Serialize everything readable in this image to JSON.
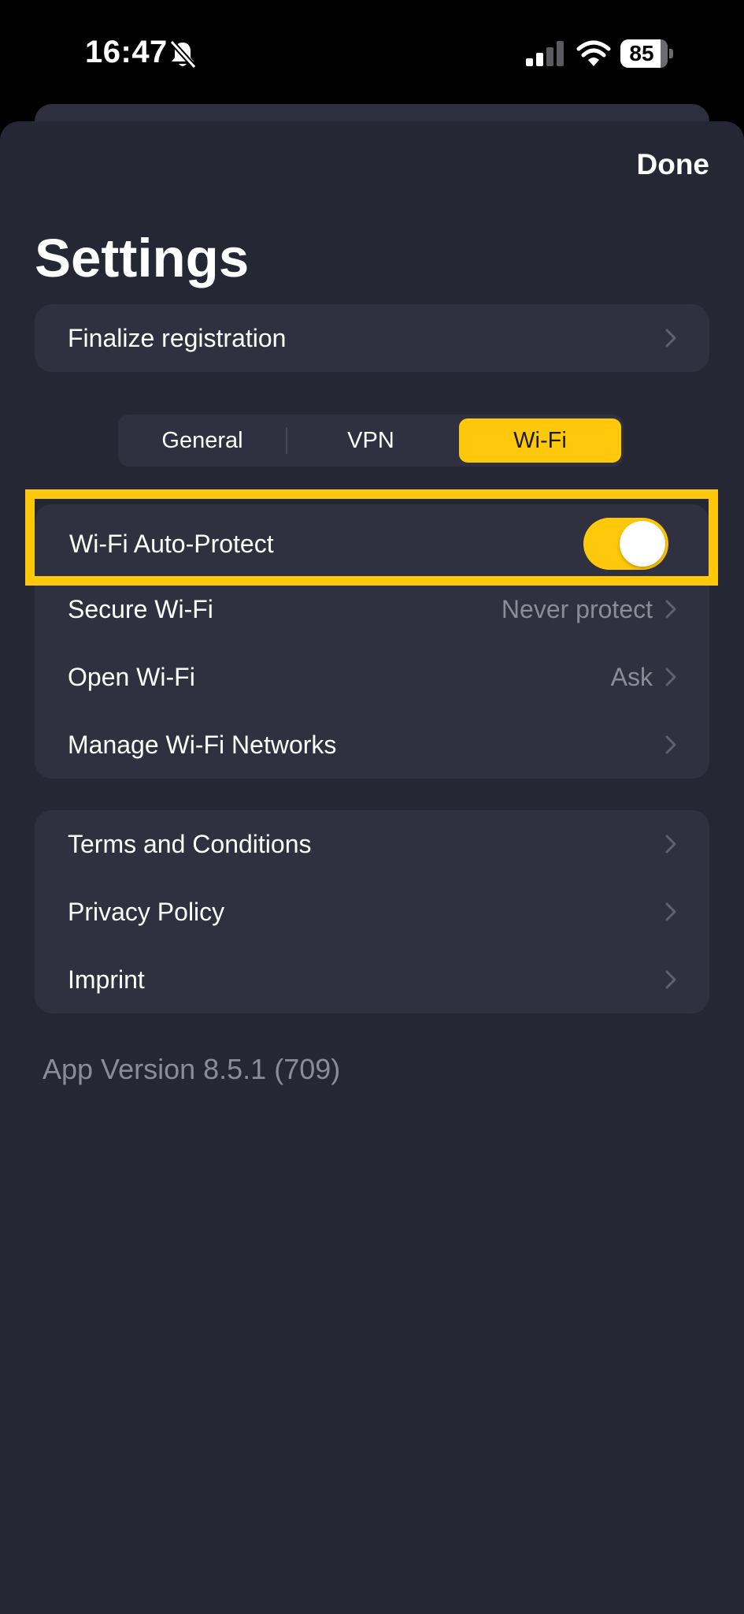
{
  "status_bar": {
    "time": "16:47",
    "battery_level": "85",
    "icons": [
      "bell-slash-icon",
      "cellular-signal-icon",
      "wifi-icon",
      "battery-icon"
    ]
  },
  "header": {
    "done_label": "Done",
    "title": "Settings"
  },
  "finalize": {
    "label": "Finalize registration"
  },
  "tabs": [
    {
      "label": "General",
      "selected": false
    },
    {
      "label": "VPN",
      "selected": false
    },
    {
      "label": "Wi-Fi",
      "selected": true
    }
  ],
  "wifi_settings": {
    "auto_protect": {
      "label": "Wi-Fi Auto-Protect",
      "enabled": true
    },
    "items": [
      {
        "label": "Secure Wi-Fi",
        "value": "Never protect"
      },
      {
        "label": "Open Wi-Fi",
        "value": "Ask"
      },
      {
        "label": "Manage Wi-Fi Networks",
        "value": ""
      }
    ]
  },
  "legal": {
    "items": [
      {
        "label": "Terms and Conditions"
      },
      {
        "label": "Privacy Policy"
      },
      {
        "label": "Imprint"
      }
    ]
  },
  "app_version": "App Version 8.5.1 (709)",
  "colors": {
    "accent": "#ffc80a",
    "background": "#262734",
    "card": "#2f3040",
    "secondary_text": "#8a8c98"
  }
}
